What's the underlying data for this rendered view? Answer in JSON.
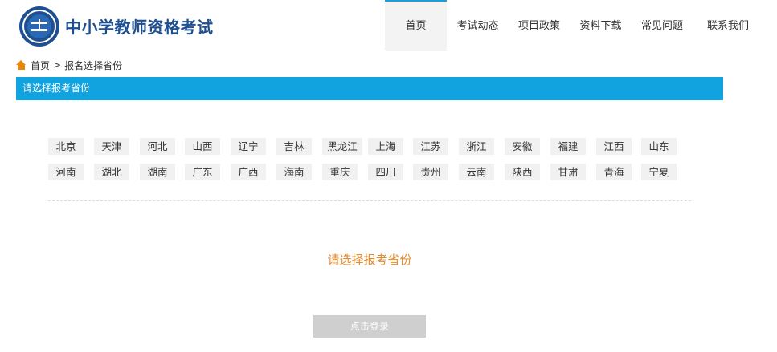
{
  "header": {
    "site_title": "中小学教师资格考试",
    "nav": [
      "首页",
      "考试动态",
      "项目政策",
      "资料下载",
      "常见问题",
      "联系我们"
    ],
    "active_nav": "首页"
  },
  "breadcrumb": {
    "home": "首页",
    "separator": ">",
    "current": "报名选择省份"
  },
  "section_title": "请选择报考省份",
  "provinces": [
    [
      "北京",
      "天津",
      "河北",
      "山西",
      "辽宁",
      "吉林",
      "黑龙江",
      "上海",
      "江苏",
      "浙江",
      "安徽",
      "福建",
      "江西",
      "山东"
    ],
    [
      "河南",
      "湖北",
      "湖南",
      "广东",
      "广西",
      "海南",
      "重庆",
      "四川",
      "贵州",
      "云南",
      "陕西",
      "甘肃",
      "青海",
      "宁夏"
    ]
  ],
  "prompt": "请选择报考省份",
  "login_button": "点击登录",
  "colors": {
    "brand": "#1d4f91",
    "section_bar": "#11a3e0",
    "prompt": "#e38b2c",
    "home_icon": "#e8870b",
    "button_disabled": "#cfcfcf"
  },
  "icons": {
    "logo": "emblem-logo",
    "home": "home-icon"
  }
}
